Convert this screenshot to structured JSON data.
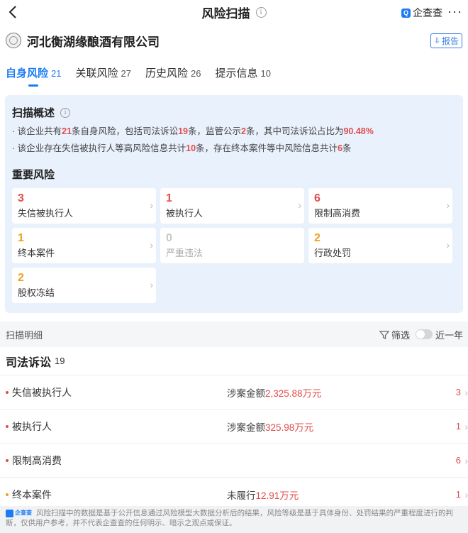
{
  "nav": {
    "title": "风险扫描",
    "info_glyph": "i",
    "brand": "企查查",
    "brand_logo": "Q",
    "more": "···"
  },
  "company": {
    "name": "河北衡湖缘酿酒有限公司",
    "report_label": "报告"
  },
  "tabs": [
    {
      "label": "自身风险",
      "count": "21",
      "active": true
    },
    {
      "label": "关联风险",
      "count": "27",
      "active": false
    },
    {
      "label": "历史风险",
      "count": "26",
      "active": false
    },
    {
      "label": "提示信息",
      "count": "10",
      "active": false
    }
  ],
  "overview": {
    "title": "扫描概述",
    "line1": {
      "p1": "· 该企业共有",
      "n1": "21",
      "p2": "条自身风险，包括司法诉讼",
      "n2": "19",
      "p3": "条，监管公示",
      "n3": "2",
      "p4": "条，其中司法诉讼占比为",
      "n4": "90.48%"
    },
    "line2": {
      "p1": "· 该企业存在失信被执行人等高风险信息共计",
      "n1": "10",
      "p2": "条，存在终本案件等中风险信息共计",
      "n2": "6",
      "p3": "条"
    },
    "important_title": "重要风险",
    "cards": [
      {
        "count": "3",
        "label": "失信被执行人",
        "level": "red"
      },
      {
        "count": "1",
        "label": "被执行人",
        "level": "red"
      },
      {
        "count": "6",
        "label": "限制高消费",
        "level": "red"
      },
      {
        "count": "1",
        "label": "终本案件",
        "level": "orange"
      },
      {
        "count": "0",
        "label": "严重违法",
        "level": "gray"
      },
      {
        "count": "2",
        "label": "行政处罚",
        "level": "orange"
      },
      {
        "count": "2",
        "label": "股权冻结",
        "level": "orange"
      }
    ]
  },
  "detail": {
    "label": "扫描明细",
    "filter_label": "筛选",
    "year_label": "近一年"
  },
  "section": {
    "title": "司法诉讼",
    "count": "19"
  },
  "rows": [
    {
      "name": "失信被执行人",
      "amount_prefix": "涉案金额",
      "amount_value": "2,325.88万元",
      "count": "3",
      "dot_color": "#e24c4c"
    },
    {
      "name": "被执行人",
      "amount_prefix": "涉案金额",
      "amount_value": "325.98万元",
      "count": "1",
      "dot_color": "#e24c4c"
    },
    {
      "name": "限制高消费",
      "amount_prefix": "",
      "amount_value": "",
      "count": "6",
      "dot_color": "#e24c4c"
    },
    {
      "name": "终本案件",
      "amount_prefix": "未履行",
      "amount_value": "12.91万元",
      "count": "1",
      "dot_color": "#f0a020"
    }
  ],
  "footer": {
    "logo_text": "企查查",
    "text": "风险扫描中的数据是基于公开信息通过风险模型大数据分析后的结果，风险等级是基于具体身份、处罚结果的严重程度进行的判断，仅供用户参考，并不代表企查查的任何明示、暗示之观点或保证。"
  },
  "colors": {
    "accent": "#1b7cf4",
    "high_risk": "#e24c4c",
    "mid_risk": "#f0a020",
    "overview_bg": "#e9f1fc"
  }
}
